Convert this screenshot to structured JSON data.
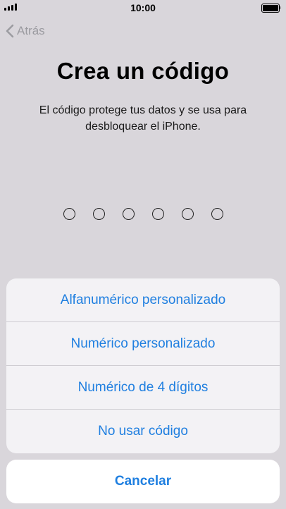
{
  "status_bar": {
    "time": "10:00"
  },
  "nav": {
    "back_label": "Atrás"
  },
  "header": {
    "title": "Crea un código",
    "subtitle": "El código protege tus datos y se usa para desbloquear el iPhone."
  },
  "passcode": {
    "length": 6
  },
  "options": {
    "items": [
      {
        "label": "Alfanumérico personalizado"
      },
      {
        "label": "Numérico personalizado"
      },
      {
        "label": "Numérico de 4 dígitos"
      },
      {
        "label": "No usar código"
      }
    ],
    "cancel_label": "Cancelar"
  },
  "colors": {
    "accent": "#1f7fe0",
    "background": "#d9d6db",
    "back_text": "#9b9ba0"
  }
}
